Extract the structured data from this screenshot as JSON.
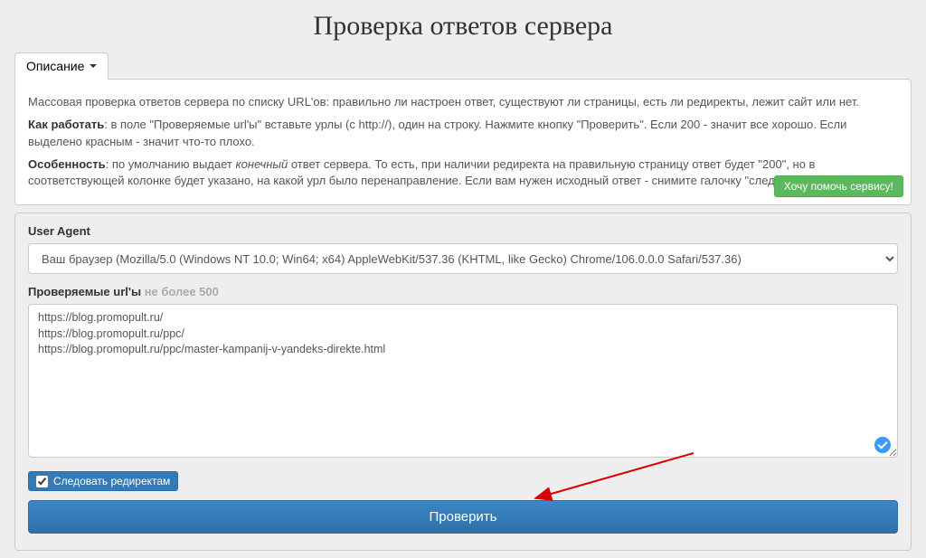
{
  "title": "Проверка ответов сервера",
  "dropdown_label": "Описание",
  "description": {
    "p1_prefix": "Массовая проверка ответов сервера по списку URL'ов: правильно ли настроен ответ, существуют ли страницы, есть ли редиректы, лежит сайт или нет.",
    "p2_bold": "Как работать",
    "p2_rest": ": в поле \"Проверяемые url'ы\" вставьте урлы (с http://), один на строку. Нажмите кнопку \"Проверить\". Если 200 - значит все хорошо. Если выделено красным - значит что-то плохо.",
    "p3_bold": "Особенность",
    "p3_before_i": ": по умолчанию выдает ",
    "p3_italic": "конечный",
    "p3_after_i": " ответ сервера. То есть, при наличии редиректа на правильную страницу ответ будет \"200\", но в соответствующей колонке будет указано, на какой урл было перенаправление. Если вам нужен исходный ответ - снимите галочку \"следовать редиректам\"."
  },
  "help_button": "Хочу помочь сервису!",
  "form": {
    "ua_label": "User Agent",
    "ua_value": "Ваш браузер (Mozilla/5.0 (Windows NT 10.0; Win64; x64) AppleWebKit/537.36 (KHTML, like Gecko) Chrome/106.0.0.0 Safari/537.36)",
    "urls_label": "Проверяемые url'ы",
    "urls_label_muted": "не более 500",
    "urls_value": "https://blog.promopult.ru/\nhttps://blog.promopult.ru/ppc/\nhttps://blog.promopult.ru/ppc/master-kampanij-v-yandeks-direkte.html",
    "follow_redirects_label": "Следовать редиректам",
    "submit_label": "Проверить"
  }
}
